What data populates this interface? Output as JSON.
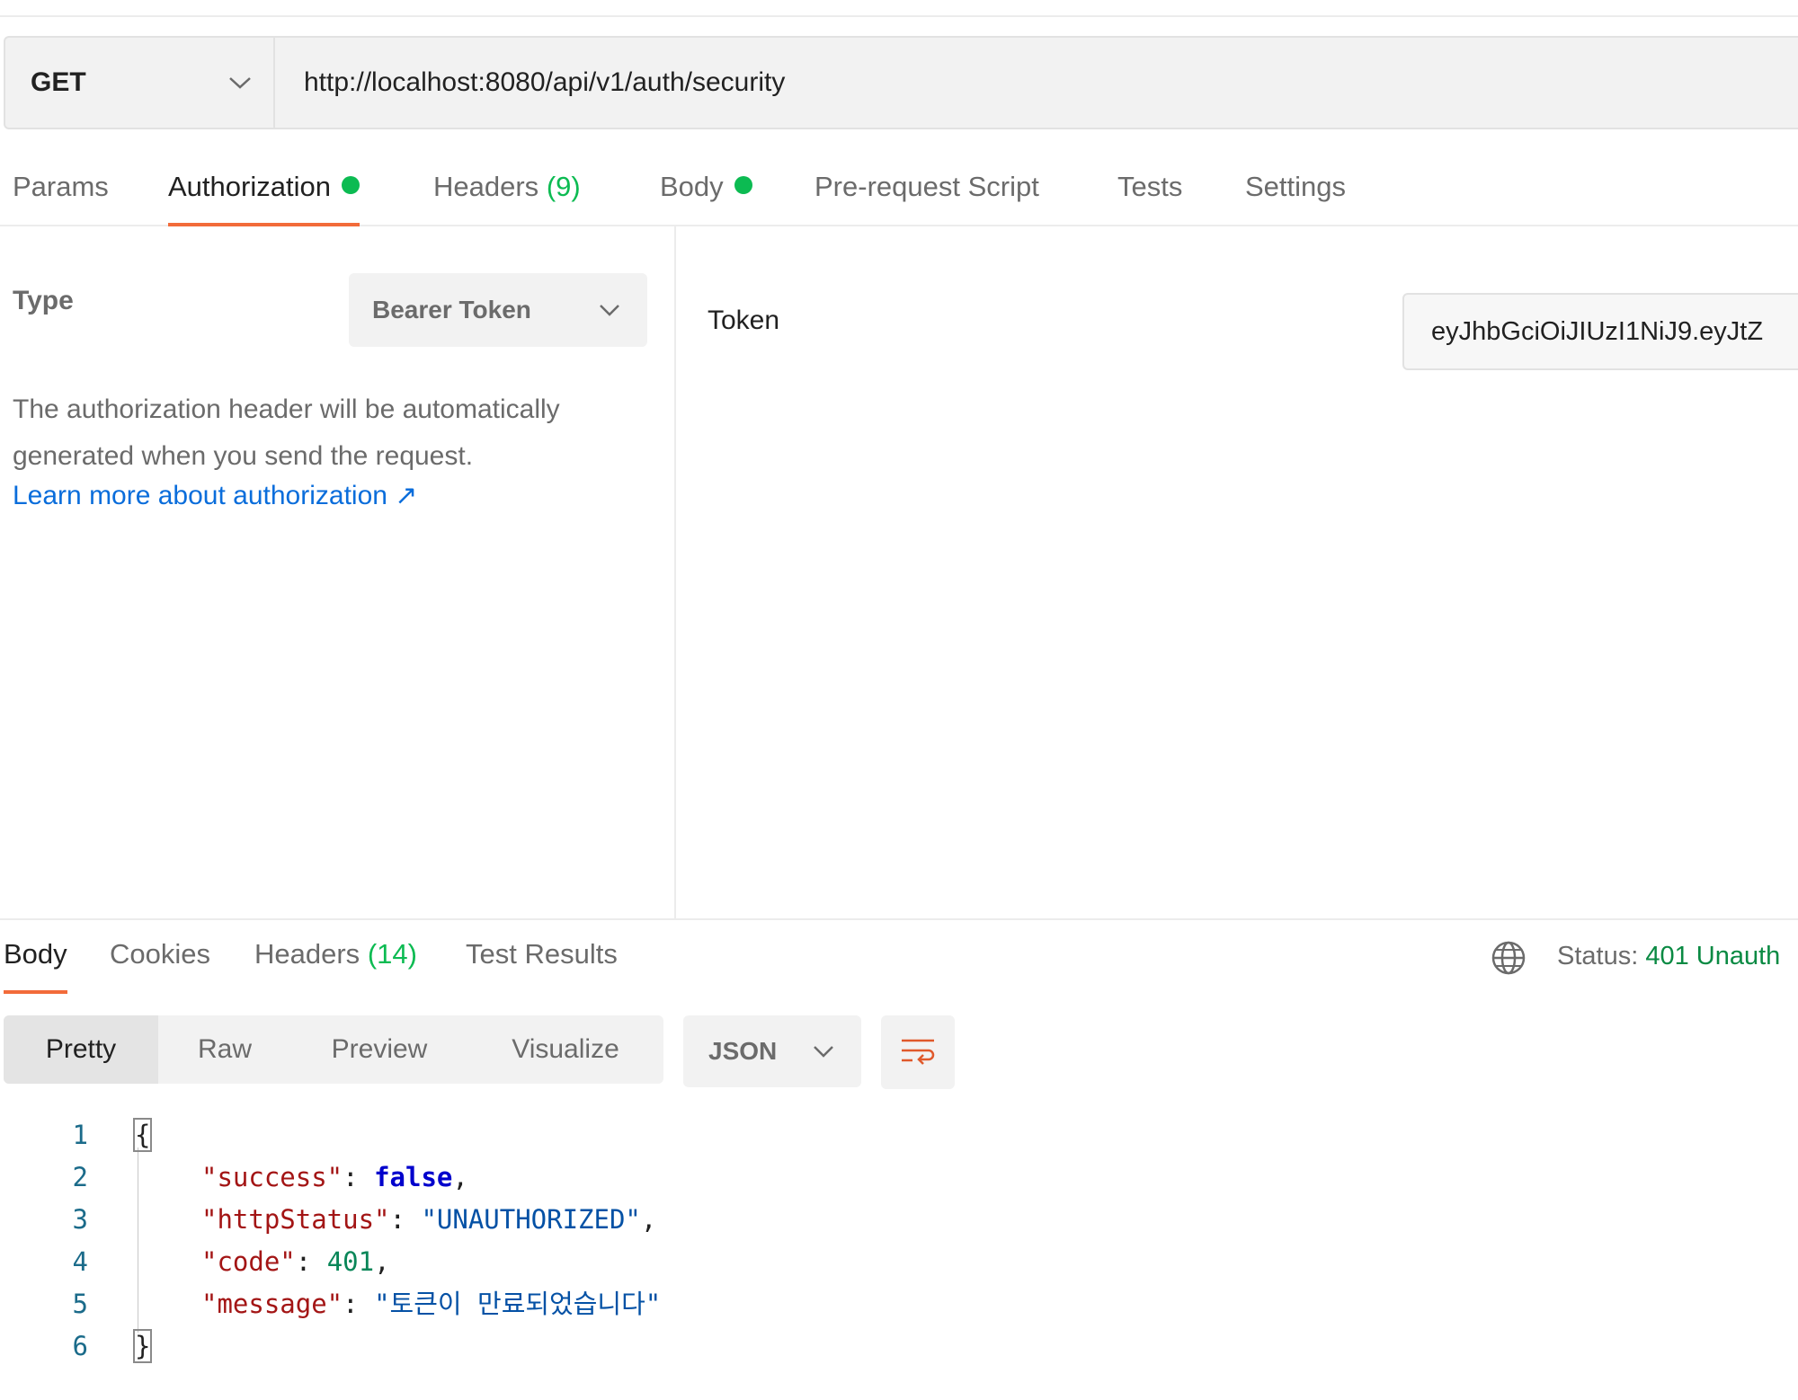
{
  "request": {
    "method": "GET",
    "url": "http://localhost:8080/api/v1/auth/security"
  },
  "request_tabs": [
    {
      "label": "Params"
    },
    {
      "label": "Authorization"
    },
    {
      "label": "Headers",
      "count": "(9)"
    },
    {
      "label": "Body"
    },
    {
      "label": "Pre-request Script"
    },
    {
      "label": "Tests"
    },
    {
      "label": "Settings"
    }
  ],
  "auth": {
    "type_label": "Type",
    "type_value": "Bearer Token",
    "description_line1": "The authorization header will be automatically",
    "description_line2": "generated when you send the request.",
    "learn_more": "Learn more about authorization ↗",
    "token_label": "Token",
    "token_value": "eyJhbGciOiJIUzI1NiJ9.eyJtZ"
  },
  "response_tabs": [
    {
      "label": "Body"
    },
    {
      "label": "Cookies"
    },
    {
      "label": "Headers",
      "count": "(14)"
    },
    {
      "label": "Test Results"
    }
  ],
  "status": {
    "label": "Status:",
    "value": "401 Unauth"
  },
  "view_modes": [
    "Pretty",
    "Raw",
    "Preview",
    "Visualize"
  ],
  "format": "JSON",
  "code": {
    "line_numbers": [
      "1",
      "2",
      "3",
      "4",
      "5",
      "6"
    ],
    "open_brace": "{",
    "close_brace": "}",
    "fields": [
      {
        "key": "\"success\"",
        "value": "false",
        "kind": "bool"
      },
      {
        "key": "\"httpStatus\"",
        "value": "\"UNAUTHORIZED\"",
        "kind": "str"
      },
      {
        "key": "\"code\"",
        "value": "401",
        "kind": "num"
      },
      {
        "key": "\"message\"",
        "value": "\"토큰이 만료되었습니다\"",
        "kind": "str"
      }
    ]
  },
  "colors": {
    "accent": "#f26b3a",
    "success_dot": "#0cbb52",
    "link": "#0a6ddb",
    "status_ok": "#0a8a43"
  }
}
